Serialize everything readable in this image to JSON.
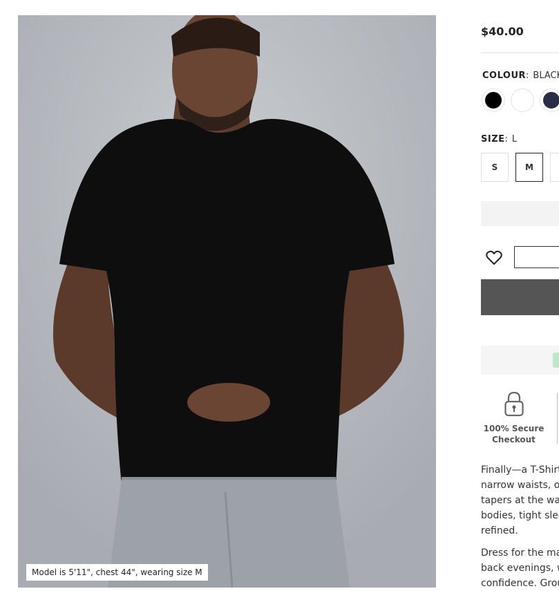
{
  "product": {
    "price": "$40.00",
    "image_caption": "Model is 5'11\", chest 44\", wearing size M"
  },
  "colour": {
    "label": "COLOUR",
    "selected": "BLACK",
    "swatches": [
      {
        "name": "black",
        "color": "#000000"
      },
      {
        "name": "white",
        "color": "#ffffff"
      },
      {
        "name": "navy",
        "color": "#2b2d48"
      }
    ]
  },
  "size": {
    "label": "SIZE",
    "selected": "L",
    "options": [
      "S",
      "M"
    ]
  },
  "trust": {
    "secure_line1": "100% Secure",
    "secure_line2": "Checkout"
  },
  "description": {
    "paragraph1": [
      "Finally—a T-Shirt",
      "narrow waists, ou",
      "tapers at the wai",
      "bodies, tight slee",
      "refined."
    ],
    "paragraph2": [
      "Dress for the ma",
      "back evenings, w",
      "confidence. Grou"
    ]
  },
  "colors": {
    "accent_dark": "#555555",
    "shirt": "#0e0e0e",
    "pants": "#9da2a8"
  }
}
